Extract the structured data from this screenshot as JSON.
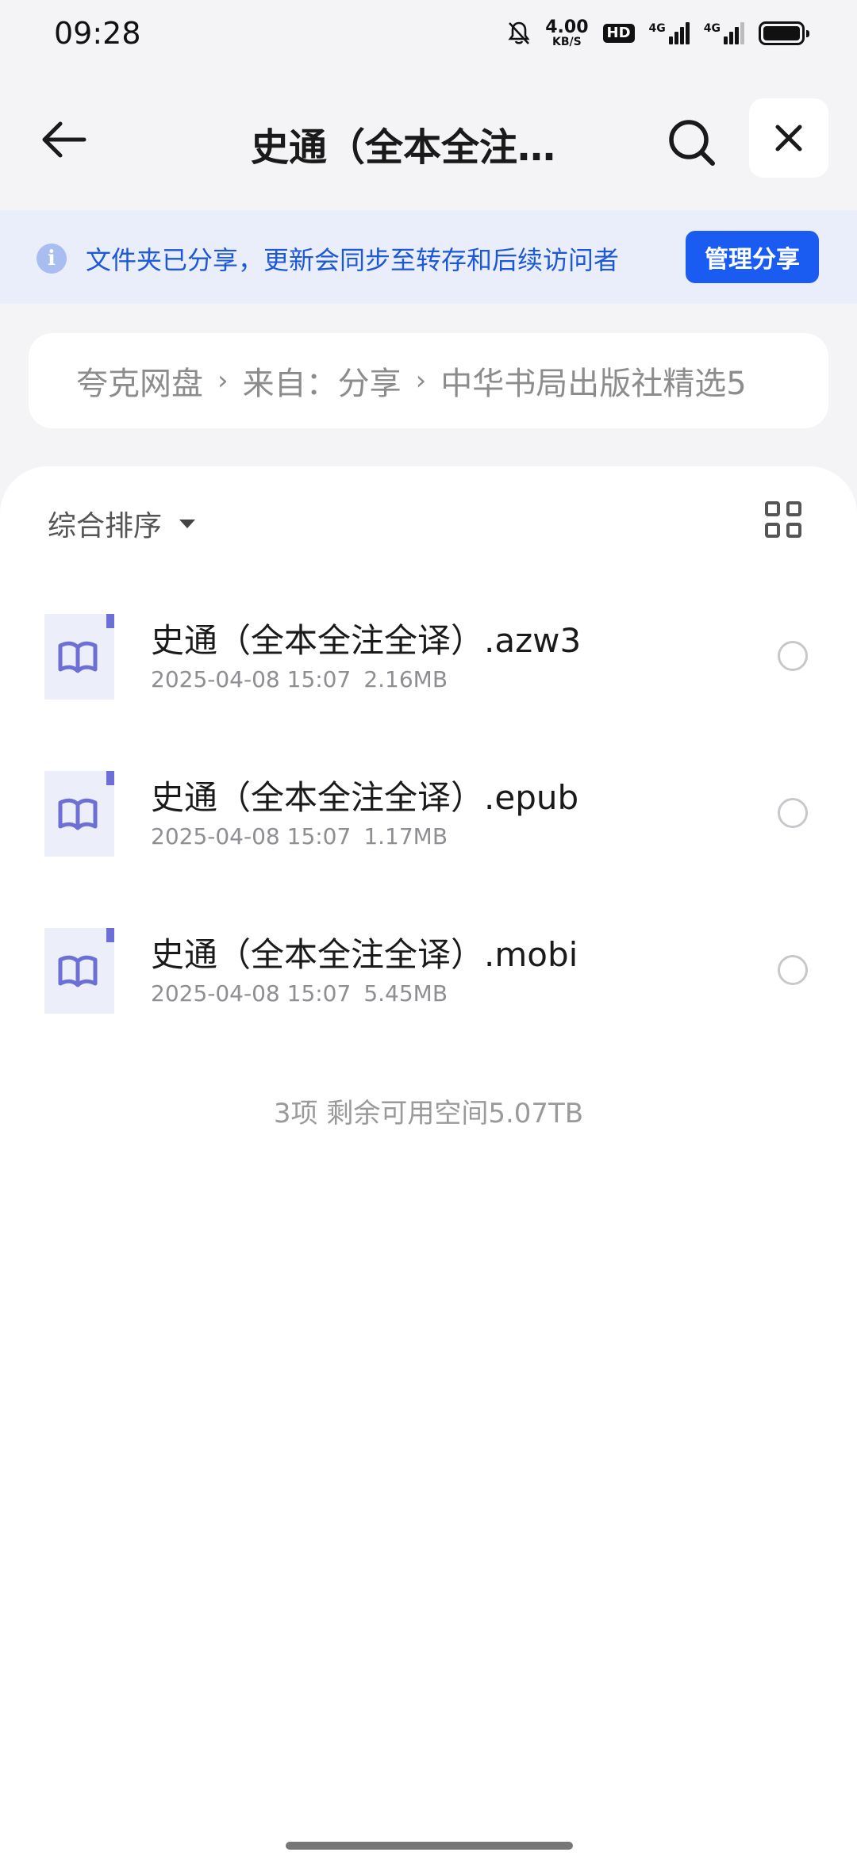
{
  "status_bar": {
    "time": "09:28",
    "net_speed_value": "4.00",
    "net_speed_unit": "KB/S",
    "hd_label": "HD",
    "sim1_label": "4G",
    "sim2_label": "4G"
  },
  "header": {
    "title": "史通（全本全注全译）",
    "back_icon": "arrow-left-icon",
    "search_icon": "search-icon",
    "close_icon": "close-icon"
  },
  "share_banner": {
    "text": "文件夹已分享，更新会同步至转存和后续访问者",
    "button_label": "管理分享",
    "accent": "#1a5cf2"
  },
  "breadcrumb": {
    "items": [
      "夸克网盘",
      "来自：分享",
      "中华书局出版社精选5"
    ]
  },
  "toolbar": {
    "sort_label": "综合排序",
    "view_toggle_icon": "grid-view-icon"
  },
  "files": [
    {
      "name": "史通（全本全注全译）.azw3",
      "date": "2025-04-08 15:07",
      "size": "2.16MB",
      "icon": "ebook-file-icon"
    },
    {
      "name": "史通（全本全注全译）.epub",
      "date": "2025-04-08 15:07",
      "size": "1.17MB",
      "icon": "ebook-file-icon"
    },
    {
      "name": "史通（全本全注全译）.mobi",
      "date": "2025-04-08 15:07",
      "size": "5.45MB",
      "icon": "ebook-file-icon"
    }
  ],
  "summary": "3项 剩余可用空间5.07TB"
}
